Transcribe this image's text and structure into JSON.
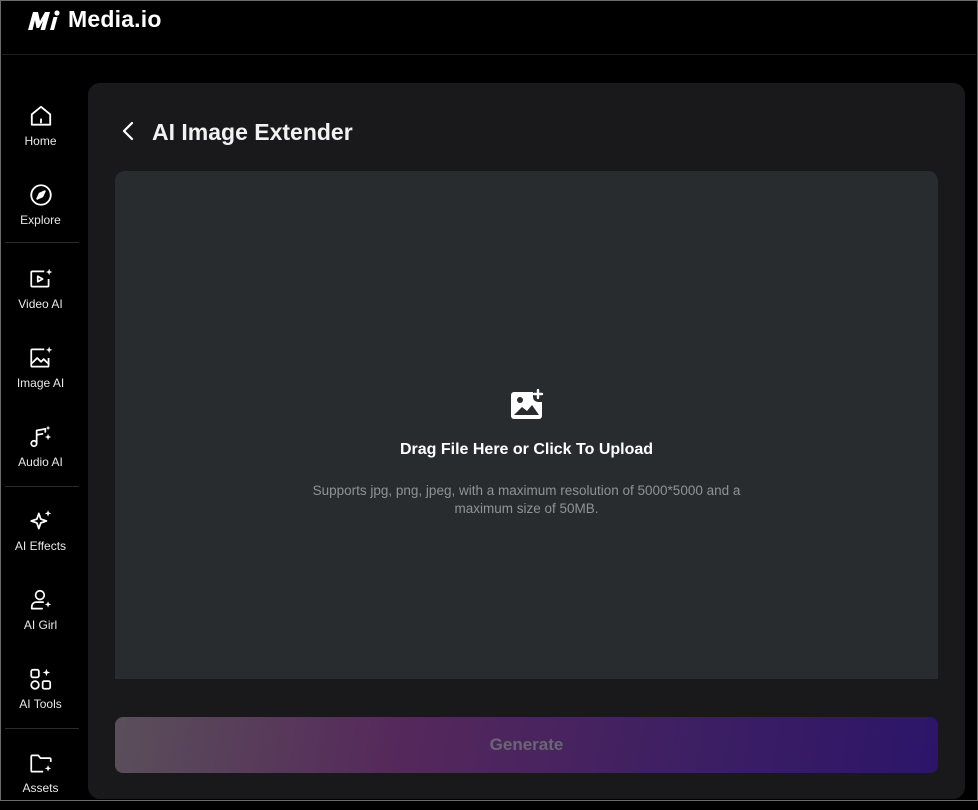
{
  "app": {
    "name": "Media.io"
  },
  "sidebar": {
    "items": [
      {
        "label": "Home",
        "icon": "home-icon"
      },
      {
        "label": "Explore",
        "icon": "compass-icon"
      },
      {
        "label": "Video AI",
        "icon": "video-ai-icon"
      },
      {
        "label": "Image AI",
        "icon": "image-ai-icon"
      },
      {
        "label": "Audio AI",
        "icon": "audio-ai-icon"
      },
      {
        "label": "AI Effects",
        "icon": "sparkle-icon"
      },
      {
        "label": "AI Girl",
        "icon": "ai-girl-icon"
      },
      {
        "label": "AI Tools",
        "icon": "ai-tools-icon"
      },
      {
        "label": "Assets",
        "icon": "folder-icon"
      }
    ]
  },
  "main": {
    "title": "AI Image Extender",
    "upload": {
      "title": "Drag File Here or Click To Upload",
      "subtitle": "Supports jpg, png, jpeg, with a maximum resolution of 5000*5000 and a maximum size of 50MB."
    },
    "generate_label": "Generate"
  },
  "colors": {
    "background": "#000000",
    "panel": "#19191b",
    "dropzone": "#282c2f",
    "generate_gradient_start": "#5a4f5a",
    "generate_gradient_end": "#2c1569"
  }
}
